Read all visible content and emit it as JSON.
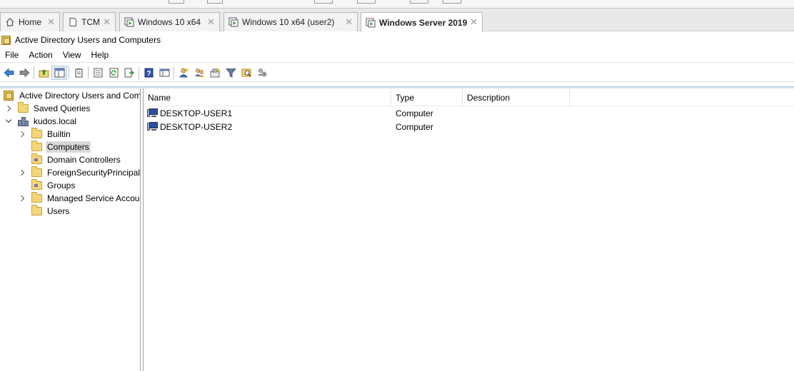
{
  "tabs": [
    {
      "label": "Home",
      "icon": "home-icon"
    },
    {
      "label": "TCM",
      "icon": "document-icon"
    },
    {
      "label": "Windows 10 x64",
      "icon": "vm-icon"
    },
    {
      "label": "Windows 10 x64 (user2)",
      "icon": "vm-icon"
    },
    {
      "label": "Windows Server 2019",
      "icon": "vm-icon",
      "active": true
    }
  ],
  "window": {
    "title": "Active Directory Users and Computers"
  },
  "menu": [
    "File",
    "Action",
    "View",
    "Help"
  ],
  "toolbar": {
    "buttons": [
      "back-arrow-icon",
      "forward-arrow-icon",
      "up-folder-icon",
      "show-tree-icon",
      "clipboard-icon",
      "properties-icon",
      "refresh-icon",
      "export-list-icon",
      "help-icon",
      "console-view-icon",
      "new-user-icon",
      "new-group-icon",
      "new-ou-icon",
      "filter-icon",
      "find-icon",
      "add-to-group-icon"
    ]
  },
  "tree": {
    "root": "Active Directory Users and Com",
    "saved_queries": "Saved Queries",
    "domain": "kudos.local",
    "children": [
      "Builtin",
      "Computers",
      "Domain Controllers",
      "ForeignSecurityPrincipals",
      "Groups",
      "Managed Service Accour",
      "Users"
    ],
    "selected": "Computers"
  },
  "list": {
    "columns": [
      "Name",
      "Type",
      "Description"
    ],
    "rows": [
      {
        "name": "DESKTOP-USER1",
        "type": "Computer",
        "description": ""
      },
      {
        "name": "DESKTOP-USER2",
        "type": "Computer",
        "description": ""
      }
    ]
  },
  "colors": {
    "accent_blue": "#d8e4f2",
    "selection": "#d9d9d9",
    "folder": "#f3d57a"
  }
}
